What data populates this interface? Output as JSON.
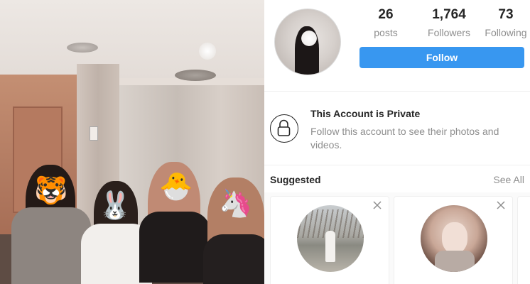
{
  "profile": {
    "stats": {
      "posts": {
        "value": "26",
        "label": "posts"
      },
      "followers": {
        "value": "1,764",
        "label": "Followers"
      },
      "following": {
        "value": "73",
        "label": "Following"
      }
    },
    "follow_label": "Follow"
  },
  "private_notice": {
    "title": "This Account is Private",
    "description": "Follow this account to see their photos and videos.",
    "icon": "lock-icon"
  },
  "suggested": {
    "title": "Suggested",
    "see_all": "See All",
    "cards": [
      {
        "avatar": "avatar-photo",
        "close_icon": "close-icon"
      },
      {
        "avatar": "avatar-photo",
        "close_icon": "close-icon"
      }
    ]
  },
  "photo": {
    "emojis": [
      "🐯",
      "🐰",
      "🐣",
      "🦄"
    ]
  },
  "colors": {
    "accent": "#3897f0",
    "text": "#262626",
    "muted": "#8e8e8e",
    "divider": "#efefef"
  }
}
